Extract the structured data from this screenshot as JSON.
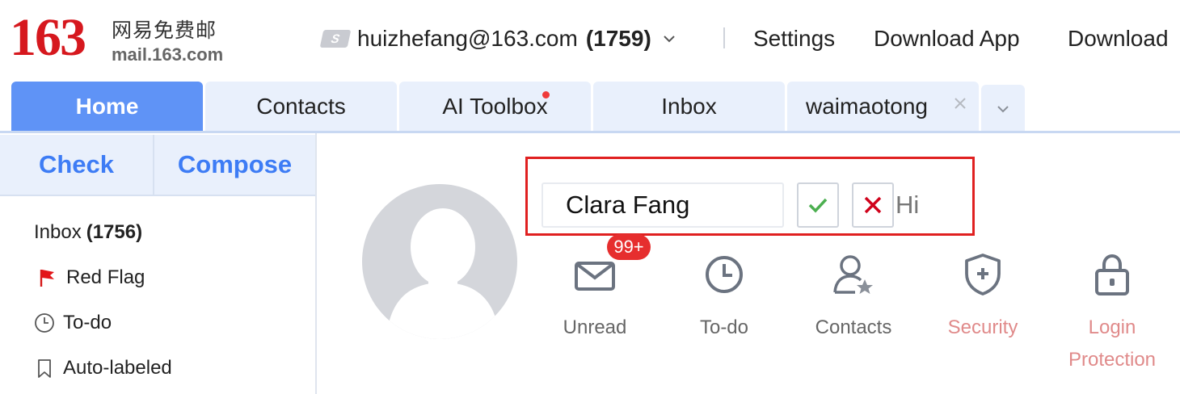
{
  "brand": {
    "logo_number": "163",
    "logo_cn": "网易免费邮",
    "logo_domain": "mail.163.com",
    "logo_color": "#d6181e"
  },
  "account": {
    "email": "huizhefang@163.com",
    "unread_count": "(1759)"
  },
  "top_links": {
    "settings": "Settings",
    "download_app": "Download App",
    "download": "Download"
  },
  "tabs": [
    {
      "label": "Home",
      "active": true
    },
    {
      "label": "Contacts"
    },
    {
      "label": "AI Toolbox",
      "has_dot": true
    },
    {
      "label": "Inbox"
    },
    {
      "label": "waimaotong",
      "closable": true
    }
  ],
  "sidebar": {
    "check_label": "Check",
    "compose_label": "Compose",
    "items": [
      {
        "label": "Inbox",
        "count": "(1756)",
        "icon": "none"
      },
      {
        "label": "Red Flag",
        "icon": "red-flag-icon"
      },
      {
        "label": "To-do",
        "icon": "clock-icon"
      },
      {
        "label": "Auto-labeled",
        "icon": "bookmark-icon"
      }
    ]
  },
  "profile": {
    "name_value": "Clara Fang",
    "greeting": "Hi",
    "features": [
      {
        "label": "Unread",
        "badge": "99+",
        "icon": "envelope-icon"
      },
      {
        "label": "To-do",
        "icon": "clock-icon"
      },
      {
        "label": "Contacts",
        "icon": "contact-star-icon"
      },
      {
        "label": "Security",
        "icon": "shield-plus-icon",
        "warn": true
      },
      {
        "label": "Login Protection",
        "icon": "lock-icon",
        "warn": true
      }
    ]
  },
  "colors": {
    "accent": "#3d7cf5",
    "active_tab": "#5f93f6",
    "tab_bg": "#e9f0fc",
    "warn_text": "#e08a8a",
    "highlight_box": "#e02020",
    "badge": "#e62e2e"
  }
}
